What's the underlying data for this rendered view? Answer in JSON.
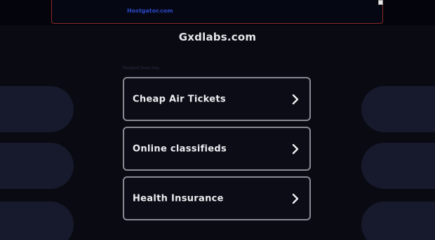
{
  "ad_banner": {
    "link_text": "Hostgator.com"
  },
  "header": {
    "domain": "Gxdlabs.com"
  },
  "related": {
    "label": "Related Searches",
    "items": [
      {
        "label": "Cheap Air Tickets"
      },
      {
        "label": "Online classifieds"
      },
      {
        "label": "Health Insurance"
      }
    ]
  },
  "colors": {
    "background": "#090a12",
    "card_border": "#8a8a92",
    "ad_border": "#8a2a24",
    "ad_link": "#2c46c4",
    "blob": "#171a2c"
  },
  "icons": {
    "card_arrow": "chevron-right-icon",
    "ad_corner": "adchoices-icon"
  }
}
